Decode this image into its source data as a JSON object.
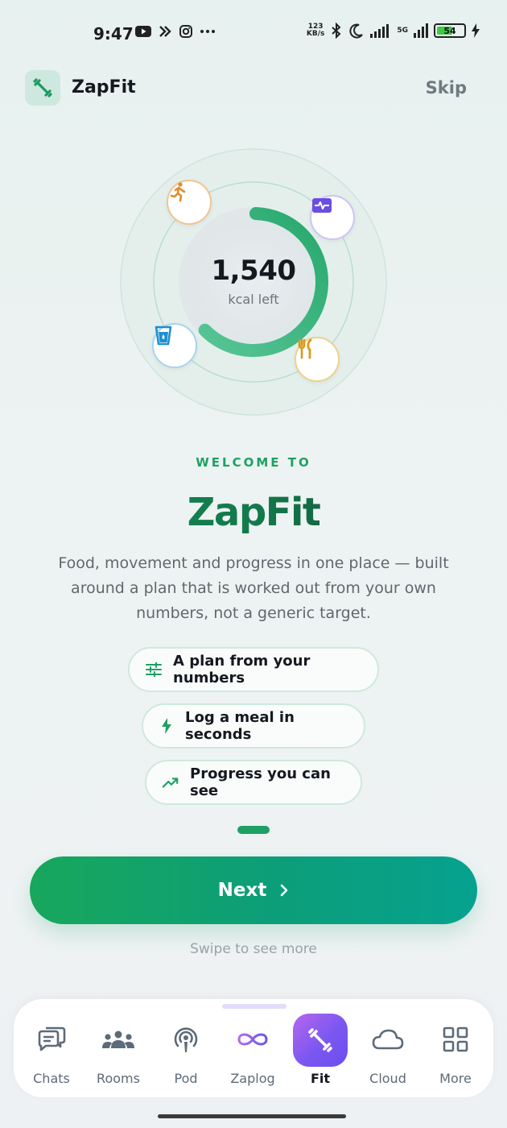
{
  "status_bar": {
    "time": "9:47",
    "left_icons": [
      "youtube-icon",
      "app-icon",
      "instagram-icon",
      "more-dots-icon"
    ],
    "speed_value": "123",
    "speed_unit": "KB/s",
    "network": "5G",
    "battery_level": "54"
  },
  "header": {
    "app_name": "ZapFit",
    "skip_label": "Skip"
  },
  "hero": {
    "value": "1,540",
    "label": "kcal left",
    "ring_progress": 0.62,
    "orbit_icons": [
      "running-icon",
      "heart-monitor-icon",
      "water-cup-icon",
      "fork-knife-icon"
    ]
  },
  "intro": {
    "welcome": "WELCOME TO",
    "title": "ZapFit",
    "description": "Food, movement and progress in one place — built around a plan that is worked out from your own numbers, not a generic target."
  },
  "features": [
    {
      "label": "A plan from your numbers",
      "icon": "sliders-icon"
    },
    {
      "label": "Log a meal in seconds",
      "icon": "bolt-icon"
    },
    {
      "label": "Progress you can see",
      "icon": "trend-up-icon"
    }
  ],
  "pager": {
    "current": 1,
    "total": 1
  },
  "cta": {
    "next_label": "Next",
    "swipe_hint": "Swipe to see more"
  },
  "bottom_nav": {
    "items": [
      {
        "label": "Chats",
        "icon": "chat-icon"
      },
      {
        "label": "Rooms",
        "icon": "people-icon"
      },
      {
        "label": "Pod",
        "icon": "podcast-icon"
      },
      {
        "label": "Zaplog",
        "icon": "infinity-icon"
      },
      {
        "label": "Fit",
        "icon": "dumbbell-icon",
        "active": true
      },
      {
        "label": "Cloud",
        "icon": "cloud-icon"
      },
      {
        "label": "More",
        "icon": "grid-icon"
      }
    ]
  },
  "colors": {
    "accent": "#1ea064",
    "ring": "#3ab57f",
    "nav_active": "#7b57f0",
    "running": "#e38b2c",
    "heart_monitor": "#6a4ee0",
    "water": "#1f8fd0",
    "fork_knife": "#d99a1c"
  }
}
